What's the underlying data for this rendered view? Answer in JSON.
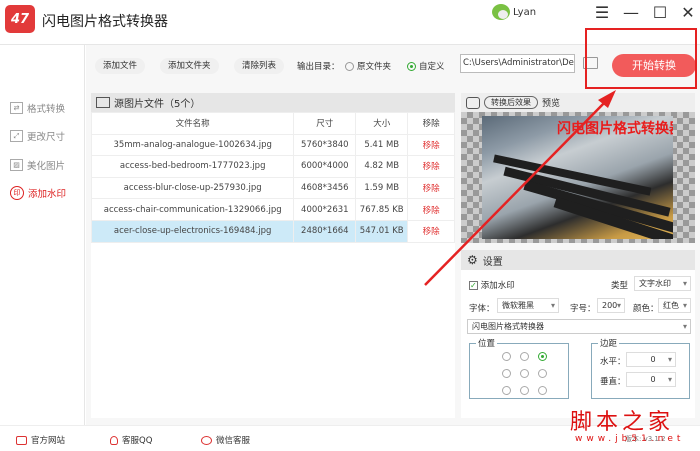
{
  "app": {
    "title": "闪电图片格式转换器",
    "logo": "47",
    "user": "Lyan"
  },
  "toolbar": {
    "add_file": "添加文件",
    "add_folder": "添加文件夹",
    "clear_list": "清除列表",
    "output_dir_label": "输出目录：",
    "opt_source": "原文件夹",
    "opt_custom": "自定义",
    "output_path": "C:\\Users\\Administrator\\De",
    "start": "开始转换"
  },
  "sidebar": {
    "items": [
      {
        "label": "格式转换",
        "icon": "⇄"
      },
      {
        "label": "更改尺寸",
        "icon": "⤢"
      },
      {
        "label": "美化图片",
        "icon": "▨"
      },
      {
        "label": "添加水印",
        "icon": "印"
      }
    ]
  },
  "files": {
    "title": "源图片文件（5个）",
    "headers": [
      "文件名称",
      "尺寸",
      "大小",
      "移除"
    ],
    "rows": [
      {
        "name": "35mm-analog-analogue-1002634.jpg",
        "size": "5760*3840",
        "bytes": "5.41 MB",
        "remove": "移除"
      },
      {
        "name": "access-bed-bedroom-1777023.jpg",
        "size": "6000*4000",
        "bytes": "4.82 MB",
        "remove": "移除"
      },
      {
        "name": "access-blur-close-up-257930.jpg",
        "size": "4608*3456",
        "bytes": "1.59 MB",
        "remove": "移除"
      },
      {
        "name": "access-chair-communication-1329066.jpg",
        "size": "4000*2631",
        "bytes": "767.85 KB",
        "remove": "移除"
      },
      {
        "name": "acer-close-up-electronics-169484.jpg",
        "size": "2480*1664",
        "bytes": "547.01 KB",
        "remove": "移除"
      }
    ]
  },
  "preview": {
    "mode": "转换后效果",
    "label": "预览",
    "watermark": "闪电图片格式转换器"
  },
  "settings": {
    "title": "设置",
    "add_watermark": "添加水印",
    "type_label": "类型",
    "type_value": "文字水印",
    "font_label": "字体：",
    "font_value": "微软雅黑",
    "size_label": "字号：",
    "size_value": "200",
    "color_label": "颜色：",
    "color_value": "红色",
    "text_value": "闪电图片格式转换器",
    "position_label": "位置",
    "margin_label": "边距",
    "h_label": "水平：",
    "h_value": "0",
    "v_label": "垂直：",
    "v_value": "0"
  },
  "footer": {
    "website": "官方网站",
    "qq": "客服QQ",
    "wechat": "微信客服",
    "version": "版本: v3.1.2",
    "jb_logo": "脚本之家",
    "jb_url": "www.jb51.net"
  },
  "colors": {
    "accent": "#f25b5b",
    "selected_row": "#cdeaf8"
  }
}
